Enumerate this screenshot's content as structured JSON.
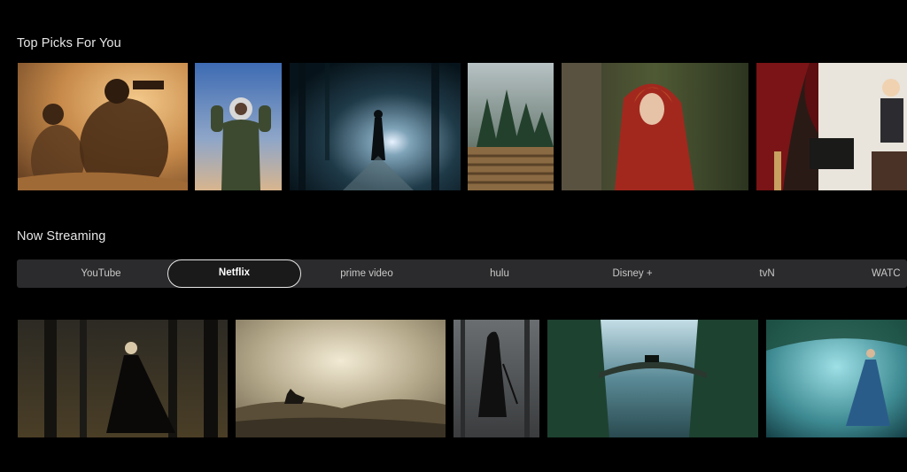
{
  "sections": {
    "top_picks_title": "Top Picks For You",
    "now_streaming_title": "Now Streaming"
  },
  "streaming": {
    "items": [
      "YouTube",
      "Netflix",
      "prime video",
      "hulu",
      "Disney +",
      "tvN",
      "WATC"
    ],
    "selected": "Netflix"
  },
  "colors": {
    "background": "#000000",
    "bar": "#2b2b2d",
    "selected_outline": "#e8e8e8"
  }
}
